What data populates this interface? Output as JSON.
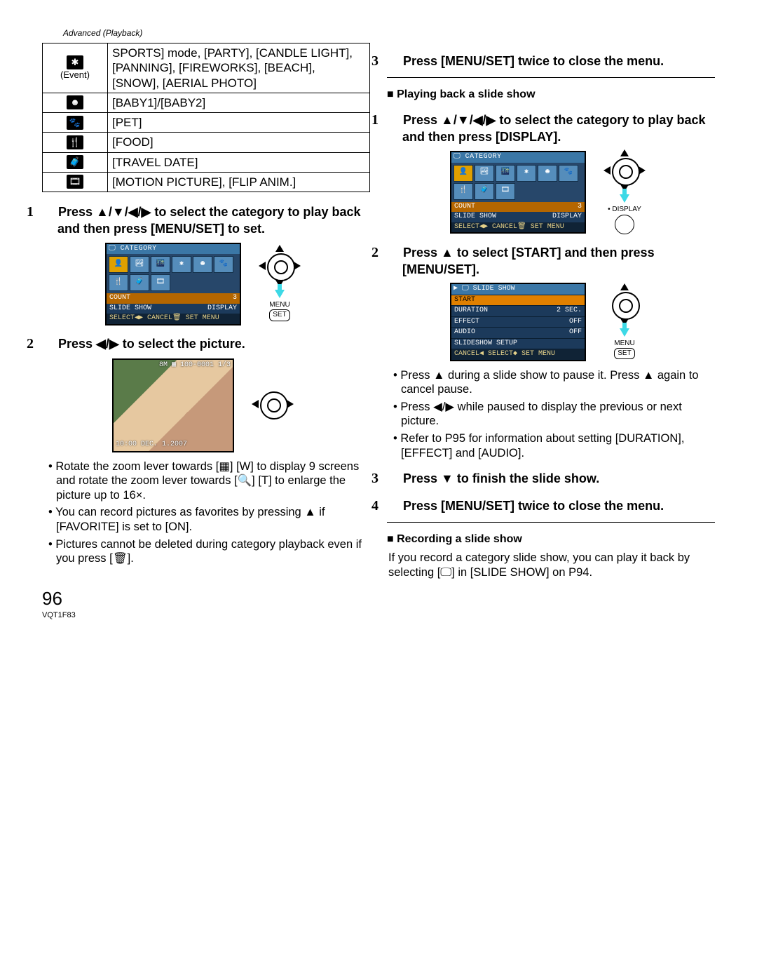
{
  "header": "Advanced (Playback)",
  "pageNumber": "96",
  "docId": "VQT1F83",
  "table": {
    "rows": [
      {
        "iconGlyph": "✱",
        "iconLabel": "(Event)",
        "text": "SPORTS] mode, [PARTY], [CANDLE LIGHT], [PANNING], [FIREWORKS], [BEACH], [SNOW], [AERIAL PHOTO]"
      },
      {
        "iconGlyph": "☻",
        "iconLabel": "",
        "text": "[BABY1]/[BABY2]"
      },
      {
        "iconGlyph": "🐾",
        "iconLabel": "",
        "text": "[PET]"
      },
      {
        "iconGlyph": "🍴",
        "iconLabel": "",
        "text": "[FOOD]"
      },
      {
        "iconGlyph": "🧳",
        "iconLabel": "",
        "text": "[TRAVEL DATE]"
      },
      {
        "iconGlyph": "🎞",
        "iconLabel": "",
        "text": "[MOTION PICTURE], [FLIP ANIM.]"
      }
    ]
  },
  "left": {
    "step1": "Press ▲/▼/◀/▶ to select the category to play back and then press [MENU/SET] to set.",
    "ctrl1": {
      "label1": "MENU",
      "label2": "SET"
    },
    "step2": "Press ◀/▶ to select the picture.",
    "notes": [
      "Rotate the zoom lever towards [▦] [W] to display 9 screens and rotate the zoom lever towards [🔍] [T] to enlarge the picture up to 16×.",
      "You can record pictures as favorites by pressing ▲ if [FAVORITE] is set to [ON].",
      "Pictures cannot be deleted during category playback even if you press [🗑]."
    ],
    "photo": {
      "top": "8M ▦\n100-0001\n1/3",
      "bottom": "10:00 DEC. 1.2007"
    }
  },
  "right": {
    "step3": "Press [MENU/SET] twice to close the menu.",
    "sub1": "Playing back a slide show",
    "s1": "Press ▲/▼/◀/▶ to select the category to play back and then press [DISPLAY].",
    "ctrl_s1": {
      "label1": "DISPLAY"
    },
    "s2": "Press ▲ to select [START] and then press [MENU/SET].",
    "ctrl_s2": {
      "label1": "MENU",
      "label2": "SET"
    },
    "notes": [
      "Press ▲ during a slide show to pause it. Press ▲ again to cancel pause.",
      "Press ◀/▶ while paused to display the previous or next picture.",
      "Refer to P95 for information about setting [DURATION], [EFFECT] and [AUDIO]."
    ],
    "s3": "Press ▼ to finish the slide show.",
    "s4": "Press [MENU/SET] twice to close the menu.",
    "sub2": "Recording a slide show",
    "body": "If you record a category slide show, you can play it back by selecting [🖵] in [SLIDE SHOW] on P94."
  },
  "screen": {
    "catTitle": "🖵 CATEGORY",
    "count": "COUNT",
    "countVal": "3",
    "slideShow": "SLIDE SHOW",
    "display": "DISPLAY",
    "bottom": "SELECT◀▶ CANCEL🗑 SET MENU",
    "slideTitle": "▶ 🖵 SLIDE SHOW",
    "menu": {
      "start": "START",
      "duration": "DURATION",
      "durationVal": "2 SEC.",
      "effect": "EFFECT",
      "effectVal": "OFF",
      "audio": "AUDIO",
      "audioVal": "OFF",
      "setup": "SLIDESHOW SETUP",
      "bottom": "CANCEL◀  SELECT◆  SET MENU"
    }
  }
}
